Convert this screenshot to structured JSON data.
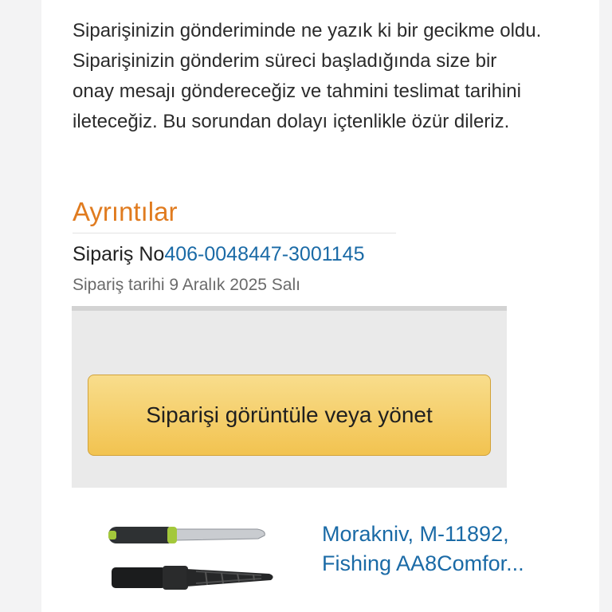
{
  "message": {
    "body": "Siparişinizin gönderiminde ne yazık ki bir gecikme oldu. Siparişinizin gönderim süreci başladığında size bir onay mesajı göndereceğiz ve tahmini teslimat tarihini ileteceğiz. Bu sorundan dolayı içtenlikle özür dileriz."
  },
  "details": {
    "title": "Ayrıntılar",
    "order_number_label": "Sipariş No",
    "order_number": "406-0048447-3001145",
    "order_date": "Sipariş tarihi 9 Aralık 2025 Salı"
  },
  "actions": {
    "manage_order_label": "Siparişi görüntüle veya yönet"
  },
  "product": {
    "icon": "fishing-knife-image",
    "title": "Morakniv, M-11892, Fishing AA8Comfor..."
  },
  "colors": {
    "accent": "#e07b1f",
    "link": "#1a6aa6",
    "button": "#f2c350"
  }
}
